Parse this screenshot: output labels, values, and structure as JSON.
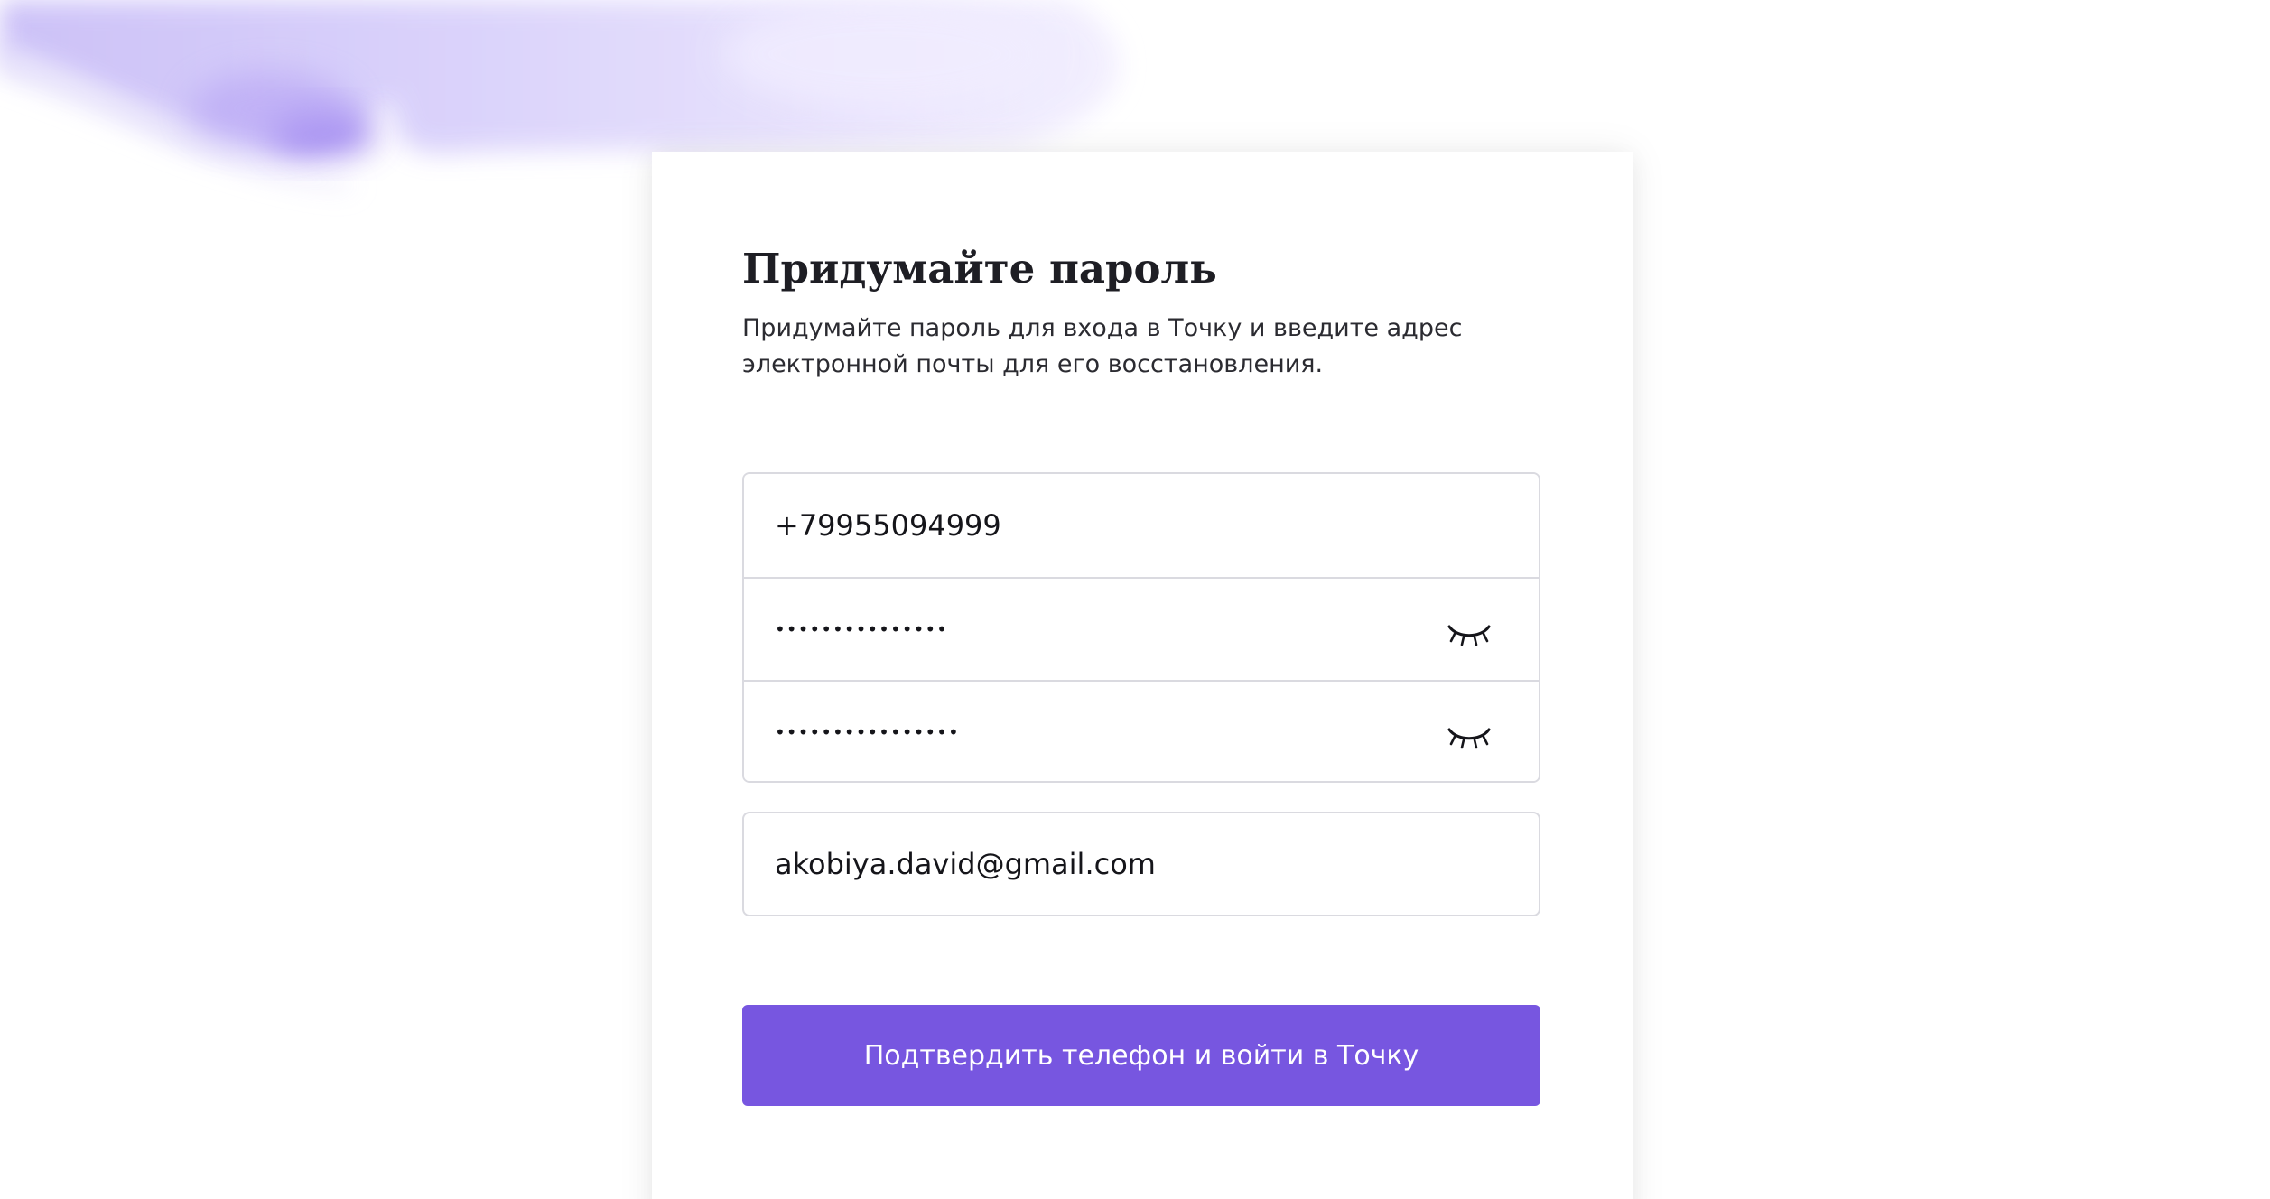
{
  "form": {
    "title": "Придумайте пароль",
    "subtitle": "Придумайте пароль для входа в Точку и введите адрес электронной почты для его восстановления.",
    "phone_value": "+79955094999",
    "password_masked": "•••••••••••••••",
    "password_confirm_masked": "••••••••••••••••",
    "email_value": "akobiya.david@gmail.com",
    "submit_label": "Подтвердить телефон и войти в Точку"
  },
  "icons": {
    "password_toggle": "eye-closed-icon",
    "password_confirm_toggle": "eye-closed-icon"
  },
  "colors": {
    "accent": "#7756e0",
    "decor_wash": "#b6a6f4",
    "input_border": "#dadae0",
    "text": "#1e1e24"
  }
}
